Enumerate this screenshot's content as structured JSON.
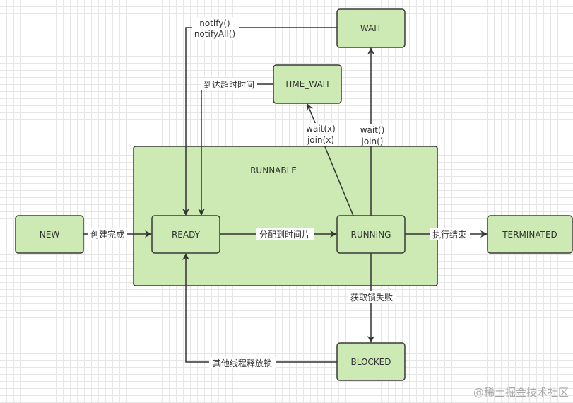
{
  "nodes": {
    "runnable": "RUNNABLE",
    "new": "NEW",
    "ready": "READY",
    "running": "RUNNING",
    "terminated": "TERMINATED",
    "blocked": "BLOCKED",
    "wait": "WAIT",
    "time_wait": "TIME_WAIT"
  },
  "edges": {
    "new_ready": "创建完成",
    "ready_running": "分配到时间片",
    "running_terminated": "执行结束",
    "running_blocked": "获取锁失败",
    "blocked_ready": "其他线程释放锁",
    "wait_ready": [
      "notify()",
      "notifyAll()"
    ],
    "time_wait_ready": "到达超时时间",
    "running_wait": [
      "wait()",
      "join()"
    ],
    "running_time_wait": [
      "wait(x)",
      "join(x)"
    ]
  },
  "watermark": "@稀土掘金技术社区",
  "colors": {
    "node_fill": "#cdeab4",
    "stroke": "#3a3a3a"
  }
}
